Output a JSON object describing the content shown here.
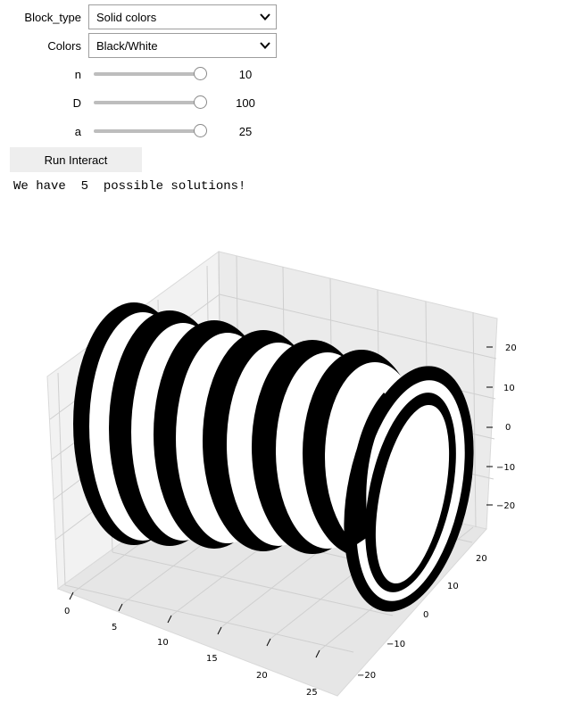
{
  "widgets": {
    "block_type": {
      "label": "Block_type",
      "value": "Solid colors"
    },
    "colors": {
      "label": "Colors",
      "value": "Black/White"
    },
    "sliders": [
      {
        "name": "n",
        "label": "n",
        "value": "10",
        "fraction": 1.0
      },
      {
        "name": "D",
        "label": "D",
        "value": "100",
        "fraction": 1.0
      },
      {
        "name": "a",
        "label": "a",
        "value": "25",
        "fraction": 1.0
      }
    ],
    "run_button": "Run Interact"
  },
  "output": {
    "message": "We have  5  possible solutions!"
  },
  "plot": {
    "type": "3d-surface",
    "stripe_colors": [
      "#000000",
      "#ffffff"
    ],
    "pane_color": "#f2f2f2",
    "grid_color": "#d9d9d9",
    "x_ticks": [
      "0",
      "5",
      "10",
      "15",
      "20",
      "25"
    ],
    "y_ticks": [
      "20",
      "10",
      "0",
      "−10",
      "−20"
    ],
    "z_ticks": [
      "20",
      "10",
      "0",
      "−10",
      "−20"
    ]
  },
  "icons": {
    "dropdown": "chevron-down-icon"
  }
}
